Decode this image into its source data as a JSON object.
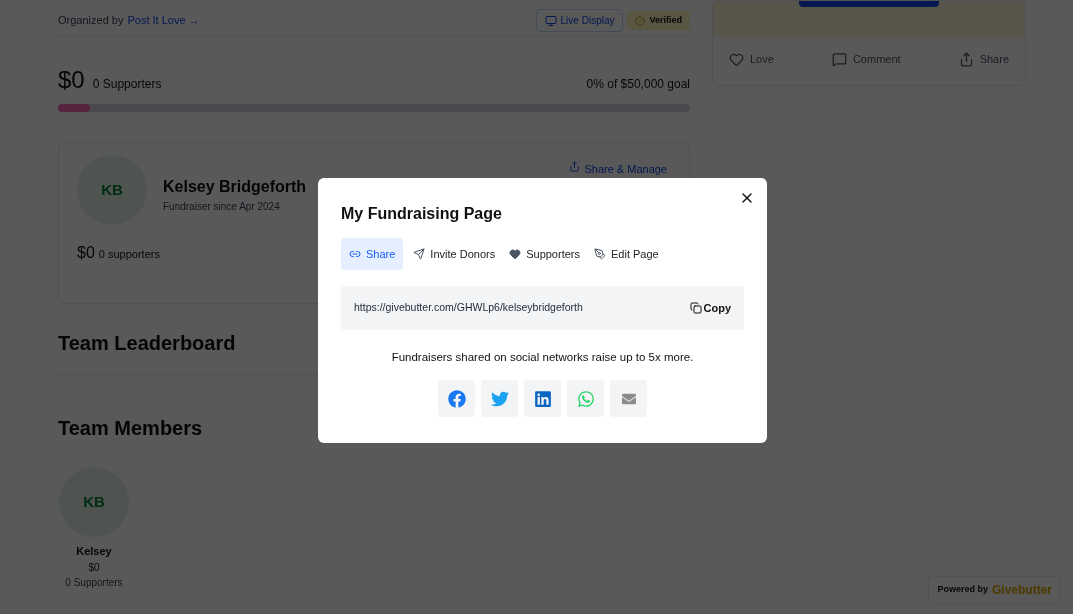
{
  "campaign": {
    "organizer_label": "Organized by",
    "organizer_link": "Post It Love →",
    "live_display": "Live Display",
    "verified": "Verified",
    "raised": "$0",
    "supporters": "0 Supporters",
    "goal": "0% of $50,000 goal",
    "level": 0.05
  },
  "actions": [
    {
      "kind": "love",
      "label": "Love"
    },
    {
      "kind": "comment",
      "label": "Comment"
    },
    {
      "kind": "share",
      "label": "Share"
    }
  ],
  "fundraiser": {
    "initials": "KB",
    "name": "Kelsey Bridgeforth",
    "since": "Fundraiser since Apr 2024",
    "share_manage": "Share & Manage",
    "raised": "$0",
    "supporters": "0 supporters"
  },
  "leaderboard_title": "Team Leaderboard",
  "members_title": "Team Members",
  "members": [
    {
      "initials": "KB",
      "name": "Kelsey",
      "raised": "$0",
      "supporters": "0 Supporters"
    }
  ],
  "modal": {
    "title": "My Fundraising Page",
    "tabs": [
      {
        "kind": "share",
        "label": "Share",
        "selected": true
      },
      {
        "kind": "invite",
        "label": "Invite Donors",
        "selected": false
      },
      {
        "kind": "supporters",
        "label": "Supporters",
        "selected": false
      },
      {
        "kind": "edit",
        "label": "Edit Page",
        "selected": false
      }
    ],
    "url": "https://givebutter.com/GHWLp6/kelseybridgeforth",
    "copy": "Copy",
    "note": "Fundraisers shared on social networks raise up to 5x more.",
    "social": [
      {
        "kind": "facebook"
      },
      {
        "kind": "twitter"
      },
      {
        "kind": "linkedin"
      },
      {
        "kind": "whatsapp"
      },
      {
        "kind": "email"
      }
    ]
  },
  "powered_by": {
    "label": "Powered by",
    "brand": "Givebutter"
  }
}
